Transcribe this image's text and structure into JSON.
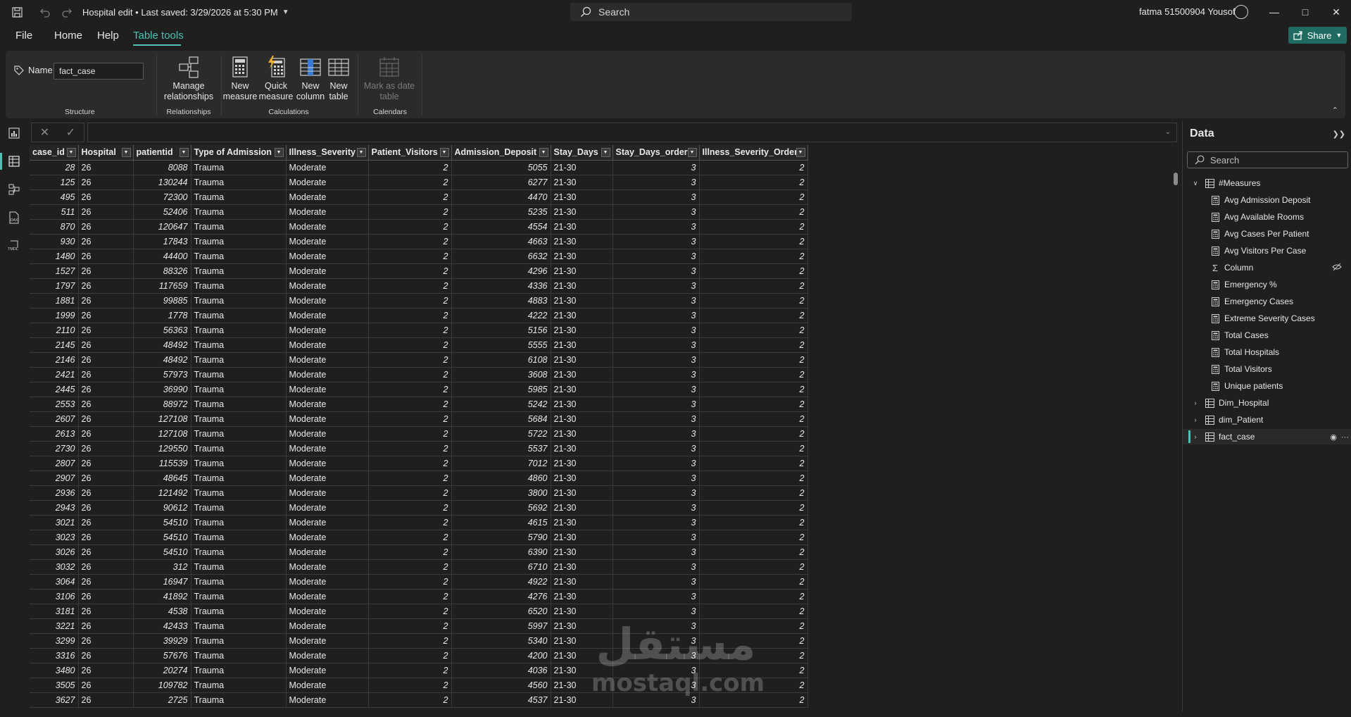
{
  "titlebar": {
    "doc_title": "Hospital edit",
    "saved_status": "Last saved: 3/29/2026 at 5:30 PM",
    "search_placeholder": "Search",
    "user_name": "fatma 51500904 Yousof"
  },
  "menu": {
    "file": "File",
    "home": "Home",
    "help": "Help",
    "table_tools": "Table tools",
    "share": "Share"
  },
  "ribbon": {
    "name_label": "Name",
    "name_value": "fact_case",
    "structure_label": "Structure",
    "relationships": {
      "button": [
        "Manage",
        "relationships"
      ],
      "label": "Relationships"
    },
    "calculations": {
      "label": "Calculations",
      "new_measure": [
        "New",
        "measure"
      ],
      "quick_measure": [
        "Quick",
        "measure"
      ],
      "new_column": [
        "New",
        "column"
      ],
      "new_table": [
        "New",
        "table"
      ]
    },
    "calendars": {
      "button": [
        "Mark as date",
        "table"
      ],
      "label": "Calendars"
    }
  },
  "table": {
    "columns": [
      "case_id",
      "Hospital",
      "patientid",
      "Type of Admission",
      "Illness_Severity",
      "Patient_Visitors",
      "Admission_Deposit",
      "Stay_Days",
      "Stay_Days_order",
      "Illness_Severity_Order"
    ],
    "rows": [
      [
        "28",
        "26",
        "8088",
        "Trauma",
        "Moderate",
        "2",
        "5055",
        "21-30",
        "3",
        "2"
      ],
      [
        "125",
        "26",
        "130244",
        "Trauma",
        "Moderate",
        "2",
        "6277",
        "21-30",
        "3",
        "2"
      ],
      [
        "495",
        "26",
        "72300",
        "Trauma",
        "Moderate",
        "2",
        "4470",
        "21-30",
        "3",
        "2"
      ],
      [
        "511",
        "26",
        "52406",
        "Trauma",
        "Moderate",
        "2",
        "5235",
        "21-30",
        "3",
        "2"
      ],
      [
        "870",
        "26",
        "120647",
        "Trauma",
        "Moderate",
        "2",
        "4554",
        "21-30",
        "3",
        "2"
      ],
      [
        "930",
        "26",
        "17843",
        "Trauma",
        "Moderate",
        "2",
        "4663",
        "21-30",
        "3",
        "2"
      ],
      [
        "1480",
        "26",
        "44400",
        "Trauma",
        "Moderate",
        "2",
        "6632",
        "21-30",
        "3",
        "2"
      ],
      [
        "1527",
        "26",
        "88326",
        "Trauma",
        "Moderate",
        "2",
        "4296",
        "21-30",
        "3",
        "2"
      ],
      [
        "1797",
        "26",
        "117659",
        "Trauma",
        "Moderate",
        "2",
        "4336",
        "21-30",
        "3",
        "2"
      ],
      [
        "1881",
        "26",
        "99885",
        "Trauma",
        "Moderate",
        "2",
        "4883",
        "21-30",
        "3",
        "2"
      ],
      [
        "1999",
        "26",
        "1778",
        "Trauma",
        "Moderate",
        "2",
        "4222",
        "21-30",
        "3",
        "2"
      ],
      [
        "2110",
        "26",
        "56363",
        "Trauma",
        "Moderate",
        "2",
        "5156",
        "21-30",
        "3",
        "2"
      ],
      [
        "2145",
        "26",
        "48492",
        "Trauma",
        "Moderate",
        "2",
        "5555",
        "21-30",
        "3",
        "2"
      ],
      [
        "2146",
        "26",
        "48492",
        "Trauma",
        "Moderate",
        "2",
        "6108",
        "21-30",
        "3",
        "2"
      ],
      [
        "2421",
        "26",
        "57973",
        "Trauma",
        "Moderate",
        "2",
        "3608",
        "21-30",
        "3",
        "2"
      ],
      [
        "2445",
        "26",
        "36990",
        "Trauma",
        "Moderate",
        "2",
        "5985",
        "21-30",
        "3",
        "2"
      ],
      [
        "2553",
        "26",
        "88972",
        "Trauma",
        "Moderate",
        "2",
        "5242",
        "21-30",
        "3",
        "2"
      ],
      [
        "2607",
        "26",
        "127108",
        "Trauma",
        "Moderate",
        "2",
        "5684",
        "21-30",
        "3",
        "2"
      ],
      [
        "2613",
        "26",
        "127108",
        "Trauma",
        "Moderate",
        "2",
        "5722",
        "21-30",
        "3",
        "2"
      ],
      [
        "2730",
        "26",
        "129550",
        "Trauma",
        "Moderate",
        "2",
        "5537",
        "21-30",
        "3",
        "2"
      ],
      [
        "2807",
        "26",
        "115539",
        "Trauma",
        "Moderate",
        "2",
        "7012",
        "21-30",
        "3",
        "2"
      ],
      [
        "2907",
        "26",
        "48645",
        "Trauma",
        "Moderate",
        "2",
        "4860",
        "21-30",
        "3",
        "2"
      ],
      [
        "2936",
        "26",
        "121492",
        "Trauma",
        "Moderate",
        "2",
        "3800",
        "21-30",
        "3",
        "2"
      ],
      [
        "2943",
        "26",
        "90612",
        "Trauma",
        "Moderate",
        "2",
        "5692",
        "21-30",
        "3",
        "2"
      ],
      [
        "3021",
        "26",
        "54510",
        "Trauma",
        "Moderate",
        "2",
        "4615",
        "21-30",
        "3",
        "2"
      ],
      [
        "3023",
        "26",
        "54510",
        "Trauma",
        "Moderate",
        "2",
        "5790",
        "21-30",
        "3",
        "2"
      ],
      [
        "3026",
        "26",
        "54510",
        "Trauma",
        "Moderate",
        "2",
        "6390",
        "21-30",
        "3",
        "2"
      ],
      [
        "3032",
        "26",
        "312",
        "Trauma",
        "Moderate",
        "2",
        "6710",
        "21-30",
        "3",
        "2"
      ],
      [
        "3064",
        "26",
        "16947",
        "Trauma",
        "Moderate",
        "2",
        "4922",
        "21-30",
        "3",
        "2"
      ],
      [
        "3106",
        "26",
        "41892",
        "Trauma",
        "Moderate",
        "2",
        "4276",
        "21-30",
        "3",
        "2"
      ],
      [
        "3181",
        "26",
        "4538",
        "Trauma",
        "Moderate",
        "2",
        "6520",
        "21-30",
        "3",
        "2"
      ],
      [
        "3221",
        "26",
        "42433",
        "Trauma",
        "Moderate",
        "2",
        "5997",
        "21-30",
        "3",
        "2"
      ],
      [
        "3299",
        "26",
        "39929",
        "Trauma",
        "Moderate",
        "2",
        "5340",
        "21-30",
        "3",
        "2"
      ],
      [
        "3316",
        "26",
        "57676",
        "Trauma",
        "Moderate",
        "2",
        "4200",
        "21-30",
        "3",
        "2"
      ],
      [
        "3480",
        "26",
        "20274",
        "Trauma",
        "Moderate",
        "2",
        "4036",
        "21-30",
        "3",
        "2"
      ],
      [
        "3505",
        "26",
        "109782",
        "Trauma",
        "Moderate",
        "2",
        "4560",
        "21-30",
        "3",
        "2"
      ],
      [
        "3627",
        "26",
        "2725",
        "Trauma",
        "Moderate",
        "2",
        "4537",
        "21-30",
        "3",
        "2"
      ]
    ],
    "text_columns": [
      3,
      4,
      7
    ]
  },
  "data_pane": {
    "title": "Data",
    "search_placeholder": "Search",
    "measures_table": "#Measures",
    "measures": [
      "Avg Admission Deposit",
      "Avg Available Rooms",
      "Avg Cases Per Patient",
      "Avg Visitors Per Case",
      "Column",
      "Emergency %",
      "Emergency Cases",
      "Extreme Severity Cases",
      "Total Cases",
      "Total Hospitals",
      "Total Visitors",
      "Unique patients"
    ],
    "tables": [
      "Dim_Hospital",
      "dim_Patient",
      "fact_case"
    ]
  },
  "watermark": {
    "arabic": "مستقل",
    "latin": "mostaql.com"
  },
  "colors": {
    "accent": "#4cc2b5",
    "share_bg": "#1f6b62",
    "background": "#1f1f1f",
    "ribbon_bg": "#2b2b2b"
  }
}
